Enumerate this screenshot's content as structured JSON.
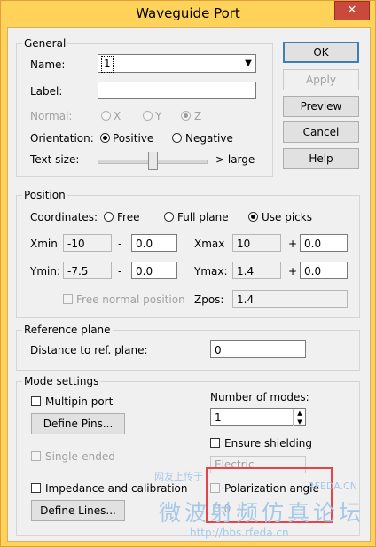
{
  "window": {
    "title": "Waveguide Port",
    "close_glyph": "✕"
  },
  "buttons": {
    "ok": "OK",
    "apply": "Apply",
    "preview": "Preview",
    "cancel": "Cancel",
    "help": "Help"
  },
  "general": {
    "legend": "General",
    "name_label": "Name:",
    "name_value": "1",
    "label_label": "Label:",
    "label_value": "",
    "normal_label": "Normal:",
    "normal_options": [
      "X",
      "Y",
      "Z"
    ],
    "normal_selected": "Z",
    "orientation_label": "Orientation:",
    "orientation_options": [
      "Positive",
      "Negative"
    ],
    "orientation_selected": "Positive",
    "textsize_label": "Text size:",
    "textsize_suffix": "> large",
    "textsize_level": 0.5
  },
  "position": {
    "legend": "Position",
    "coordinates_label": "Coordinates:",
    "coord_options": [
      "Free",
      "Full plane",
      "Use picks"
    ],
    "coord_selected": "Use picks",
    "xmin_label": "Xmin",
    "xmin_value": "-10",
    "xmin_op": "-",
    "xmin_offset": "0.0",
    "xmax_label": "Xmax",
    "xmax_value": "10",
    "xmax_op": "+",
    "xmax_offset": "0.0",
    "ymin_label": "Ymin:",
    "ymin_value": "-7.5",
    "ymin_op": "-",
    "ymin_offset": "0.0",
    "ymax_label": "Ymax:",
    "ymax_value": "1.4",
    "ymax_op": "+",
    "ymax_offset": "0.0",
    "free_normal_label": "Free normal position",
    "zpos_label": "Zpos:",
    "zpos_value": "1.4"
  },
  "reference": {
    "legend": "Reference plane",
    "distance_label": "Distance to ref. plane:",
    "distance_value": "0"
  },
  "mode": {
    "legend": "Mode settings",
    "multipin_label": "Multipin port",
    "define_pins": "Define Pins...",
    "single_ended": "Single-ended",
    "impedance_label": "Impedance and calibration",
    "define_lines": "Define Lines...",
    "num_modes_label": "Number of modes:",
    "num_modes_value": "1",
    "ensure_shielding": "Ensure shielding",
    "electric_value": "Electric",
    "polarization_label": "Polarization angle",
    "polarization_value": "0.0"
  },
  "watermark": {
    "top": "网友上传于",
    "brand": "RFEDA.CN",
    "chinese": "微波射频仿真论坛",
    "url": "http://bbs.rfeda.cn"
  },
  "colors": {
    "title_bar": "#ffd25a",
    "close": "#c94a3a",
    "highlight": "#e0464c",
    "watermark": "#a8c8e8"
  }
}
